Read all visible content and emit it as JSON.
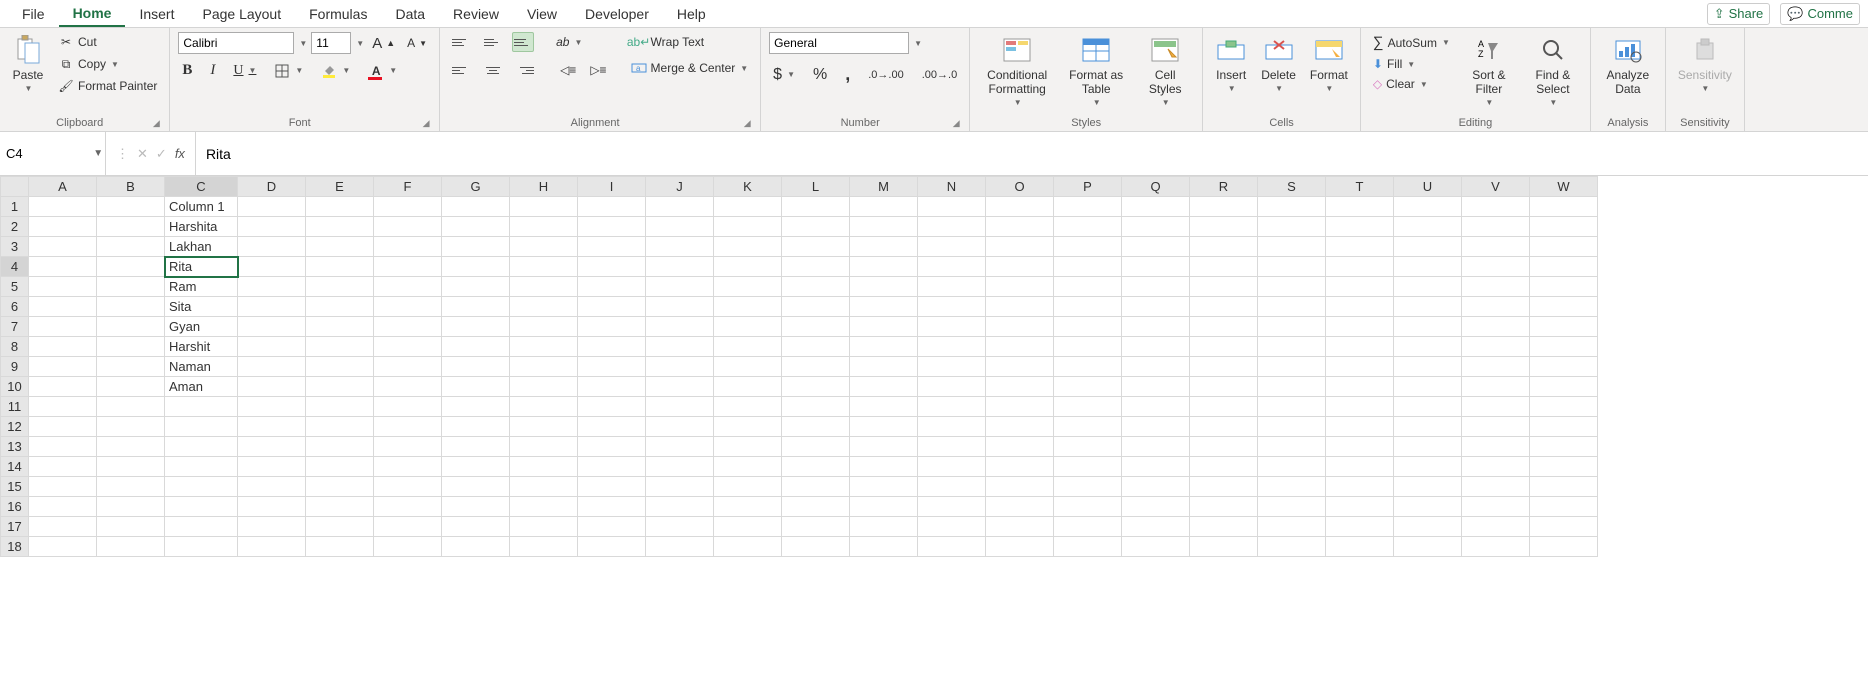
{
  "tabs": [
    "File",
    "Home",
    "Insert",
    "Page Layout",
    "Formulas",
    "Data",
    "Review",
    "View",
    "Developer",
    "Help"
  ],
  "active_tab": "Home",
  "share": "Share",
  "comment": "Comme",
  "clipboard": {
    "paste": "Paste",
    "cut": "Cut",
    "copy": "Copy",
    "format_painter": "Format Painter",
    "label": "Clipboard"
  },
  "font": {
    "name": "Calibri",
    "size": "11",
    "label": "Font"
  },
  "alignment": {
    "wrap": "Wrap Text",
    "merge": "Merge & Center",
    "label": "Alignment"
  },
  "number": {
    "format": "General",
    "label": "Number"
  },
  "styles": {
    "cond": "Conditional Formatting",
    "table": "Format as Table",
    "cell": "Cell Styles",
    "label": "Styles"
  },
  "cells": {
    "insert": "Insert",
    "delete": "Delete",
    "format": "Format",
    "label": "Cells"
  },
  "editing": {
    "autosum": "AutoSum",
    "fill": "Fill",
    "clear": "Clear",
    "sort": "Sort & Filter",
    "find": "Find & Select",
    "label": "Editing"
  },
  "analysis": {
    "analyze": "Analyze Data",
    "label": "Analysis"
  },
  "sensitivity": {
    "btn": "Sensitivity",
    "label": "Sensitivity"
  },
  "name_box": "C4",
  "formula": "Rita",
  "columns": [
    "A",
    "B",
    "C",
    "D",
    "E",
    "F",
    "G",
    "H",
    "I",
    "J",
    "K",
    "L",
    "M",
    "N",
    "O",
    "P",
    "Q",
    "R",
    "S",
    "T",
    "U",
    "V",
    "W"
  ],
  "rows": 18,
  "selected_cell": "C4",
  "cells_data": {
    "C1": "Column 1",
    "C2": "Harshita",
    "C3": "Lakhan",
    "C4": "Rita",
    "C5": "Ram",
    "C6": "Sita",
    "C7": "Gyan",
    "C8": "Harshit",
    "C9": "Naman",
    "C10": "Aman"
  }
}
